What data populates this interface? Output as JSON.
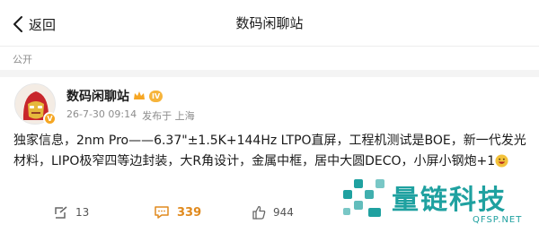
{
  "header": {
    "back_label": "返回",
    "title": "数码闲聊站"
  },
  "visibility": "公开",
  "post": {
    "author": "数码闲聊站",
    "level": "IV",
    "time": "26-7-30 09:14",
    "source": "发布于 上海",
    "text": "独家信息，2nm Pro——6.37\"±1.5K+144Hz LTPO直屏，工程机测试是BOE，新一代发光材料，LIPO极窄四等边封装，大R角设计，金属中框，居中大圆DECO，小屏小钢炮+1"
  },
  "actions": {
    "reposts": "13",
    "comments": "339",
    "likes": "944"
  },
  "watermark": {
    "text": "量链科技",
    "url": "QFSP.NET"
  },
  "colors": {
    "accent_orange": "#e08a1e",
    "badge_gold": "#f6b43b",
    "watermark_teal": "#1fa1a0"
  },
  "icons": [
    "chevron-left-icon",
    "repost-icon",
    "comment-icon",
    "like-icon",
    "crown-icon",
    "verified-icon",
    "emoji-icon"
  ]
}
